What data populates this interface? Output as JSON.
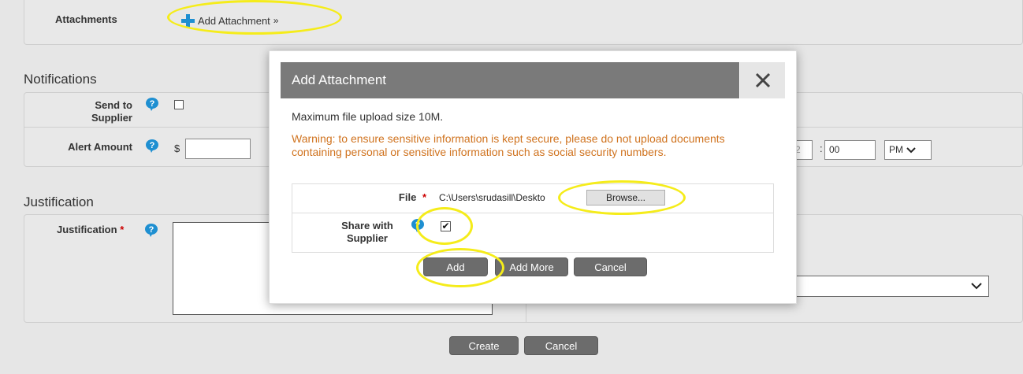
{
  "attachments": {
    "label": "Attachments",
    "add_link": "Add Attachment",
    "add_link_suffix": "»"
  },
  "notifications": {
    "title": "Notifications",
    "send_to_supplier_line1": "Send to",
    "send_to_supplier_line2": "Supplier",
    "alert_amount_label": "Alert Amount",
    "currency": "$",
    "time_minutes": "00",
    "time_colon": ":",
    "time_ampm": "PM",
    "time_hour_partial": "2"
  },
  "justification": {
    "title": "Justification",
    "field_label": "Justification",
    "required": "*"
  },
  "footer": {
    "create_label": "Create",
    "cancel_label": "Cancel"
  },
  "modal": {
    "title": "Add Attachment",
    "close_glyph": "✕",
    "max_size": "Maximum file upload size 10M.",
    "warning": "Warning: to ensure sensitive information is kept secure, please do not upload documents containing personal or sensitive information such as social security numbers.",
    "file_label": "File",
    "required": "*",
    "file_value": "C:\\Users\\srudasill\\Deskto",
    "browse_label": "Browse...",
    "share_line1": "Share with",
    "share_line2": "Supplier",
    "share_checked": "✔",
    "add_label": "Add",
    "add_more_label": "Add More",
    "cancel_label": "Cancel"
  },
  "colors": {
    "help_icon": "#1e8fd1",
    "plus_icon": "#1e8fd1",
    "warning_text": "#d0731f",
    "required": "#cc0000",
    "highlight_ring": "#f5ec1a",
    "button_bg": "#6c6c6c"
  }
}
